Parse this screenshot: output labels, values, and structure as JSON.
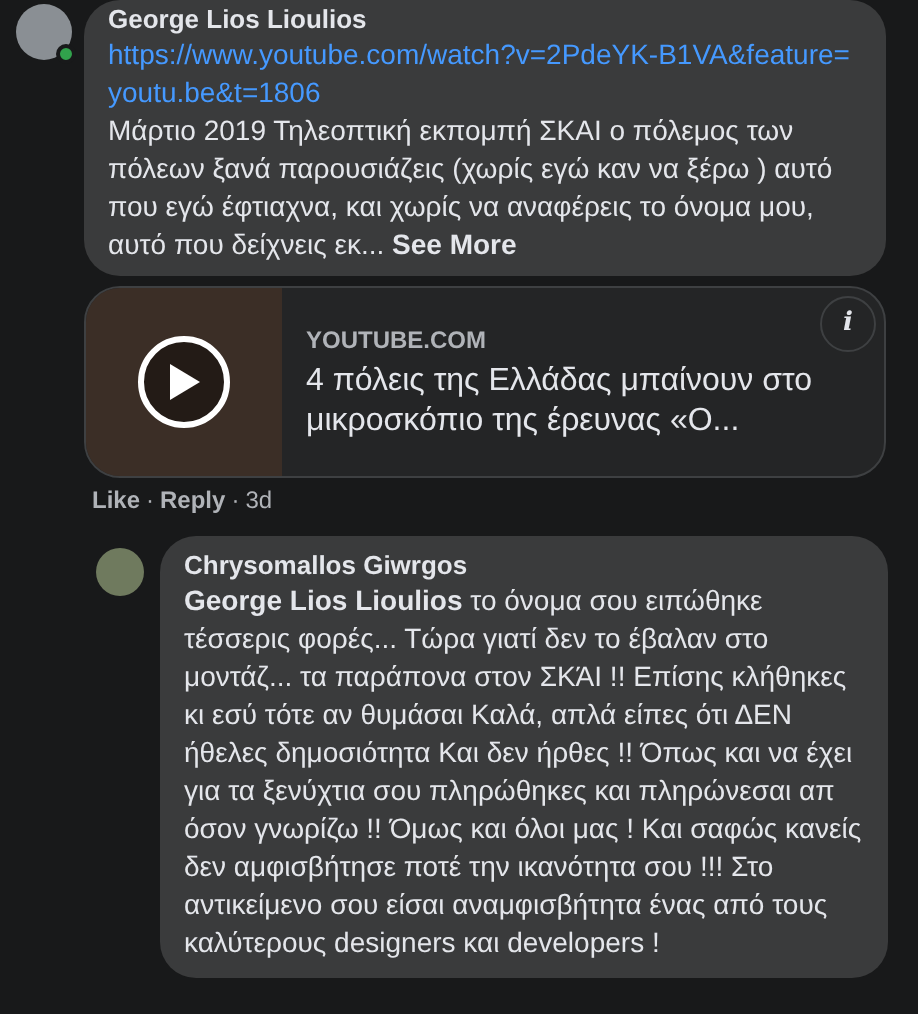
{
  "comment": {
    "author": "George Lios Lioulios",
    "online": true,
    "link": "https://www.youtube.com/watch?v=2PdeYK-B1VA&feature=youtu.be&t=1806",
    "text": "Μάρτιο 2019 Τηλεοπτική εκπομπή ΣΚΑΙ ο πόλεμος των πόλεων ξανά παρουσιάζεις (χωρίς εγώ καν να ξέρω ) αυτό που εγώ έφτιαχνα, και χωρίς να αναφέρεις το όνομα μου, αυτό που δείχνεις εκ...",
    "see_more": "See More"
  },
  "link_preview": {
    "info": "i",
    "domain": "YOUTUBE.COM",
    "title": "4 πόλεις της Ελλάδας μπαίνουν στο μικροσκόπιο της έρευνας «Ο..."
  },
  "actions": [
    {
      "label": "Like",
      "kind": "link"
    },
    {
      "label": "·",
      "kind": "separator"
    },
    {
      "label": "Reply",
      "kind": "link"
    },
    {
      "label": "·",
      "kind": "separator"
    },
    {
      "label": "3d",
      "kind": "time"
    }
  ],
  "reply": {
    "author": "Chrysomallos Giwrgos",
    "text": "**George Lios Lioulios** το όνομα σου ειπώθηκε τέσσερις φορές... Τώρα γιατί δεν το έβαλαν στο μοντάζ... τα παράπονα στον ΣΚΆΙ !! Επίσης κλήθηκες κι εσύ τότε αν θυμάσαι Καλά, απλά είπες ότι ΔΕΝ ήθελες δημοσιότητα Και δεν ήρθες !! Όπως και να έχει για τα ξενύχτια σου πληρώθηκες και πληρώνεσαι απ όσον γνωρίζω !! Όμως και όλοι μας ! Και σαφώς κανείς δεν αμφισβήτησε ποτέ την ικανότητα σου !!! Στο αντικείμενο σου είσαι αναμφισβήτητα ένας από τους καλύτερους designers και developers !"
  }
}
